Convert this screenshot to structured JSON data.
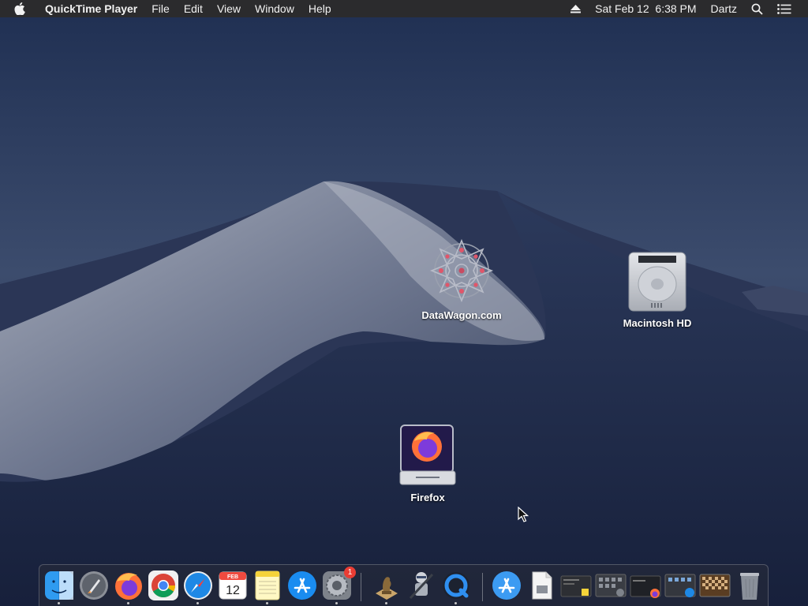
{
  "menubar": {
    "app_name": "QuickTime Player",
    "menus": [
      "File",
      "Edit",
      "View",
      "Window",
      "Help"
    ],
    "clock": "Sat Feb 12  6:38 PM",
    "user": "Dartz"
  },
  "desktop": {
    "icons": [
      {
        "label": "DataWagon.com",
        "icon": "datawagon-mandala-icon"
      },
      {
        "label": "Macintosh HD",
        "icon": "hard-drive-icon"
      },
      {
        "label": "Firefox",
        "icon": "firefox-disk-image-icon"
      }
    ]
  },
  "dock": {
    "calendar": {
      "month": "FEB",
      "day": "12"
    },
    "settings_badge": "1",
    "apps": [
      "Finder",
      "Launchpad",
      "Firefox",
      "Google Chrome",
      "Safari",
      "Calendar",
      "Notes",
      "App Store",
      "System Preferences",
      "Chess",
      "Automator",
      "QuickTime Player"
    ],
    "others": [
      "Applications",
      "Documents",
      "Window thumbnail 1",
      "Window thumbnail 2",
      "Window thumbnail 3",
      "Window thumbnail 4",
      "Chess window",
      "Trash"
    ]
  },
  "colors": {
    "menubar_bg": "#2b2b2d",
    "wallpaper_sky": "#1b2746",
    "badge_red": "#ea3d34"
  }
}
